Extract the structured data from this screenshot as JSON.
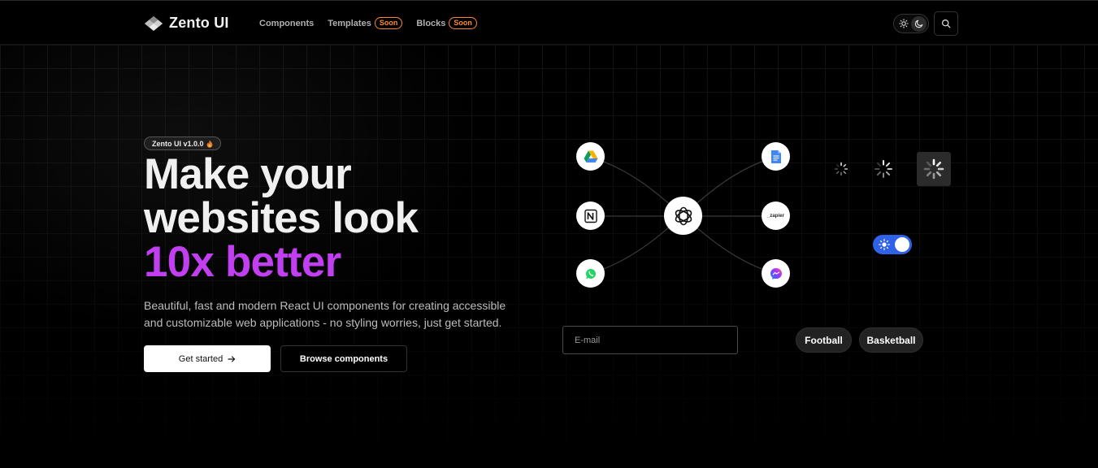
{
  "brand": {
    "name": "Zento UI"
  },
  "nav": {
    "items": [
      {
        "label": "Components",
        "badge": ""
      },
      {
        "label": "Templates",
        "badge": "Soon"
      },
      {
        "label": "Blocks",
        "badge": "Soon"
      }
    ]
  },
  "header": {
    "theme_toggle": {
      "options": [
        "sun-icon",
        "moon-icon"
      ],
      "active": "moon-icon"
    },
    "search_icon": "search-icon"
  },
  "hero": {
    "badge": "Zento UI v1.0.0",
    "title_line1": "Make your",
    "title_line2": "websites look",
    "title_accent": "10x better",
    "description": "Beautiful, fast and modern React UI components for creating accessible and customizable web applications - no styling worries, just get started.",
    "cta_primary": "Get started",
    "cta_secondary": "Browse components"
  },
  "showcase": {
    "integrations": {
      "center": "openai-icon",
      "left": [
        "google-drive-icon",
        "notion-icon",
        "whatsapp-icon"
      ],
      "right": [
        "google-docs-icon",
        "zapier-icon",
        "messenger-icon"
      ],
      "zapier_text": "_zapier"
    },
    "switch": {
      "on": true
    },
    "email": {
      "placeholder": "E-mail",
      "value": ""
    },
    "chips": [
      "Football",
      "Basketball"
    ]
  },
  "colors": {
    "background": "#000000",
    "accent": "#c13ff0",
    "soon_badge": "#ff8a2b",
    "switch": "#2f62e6"
  }
}
